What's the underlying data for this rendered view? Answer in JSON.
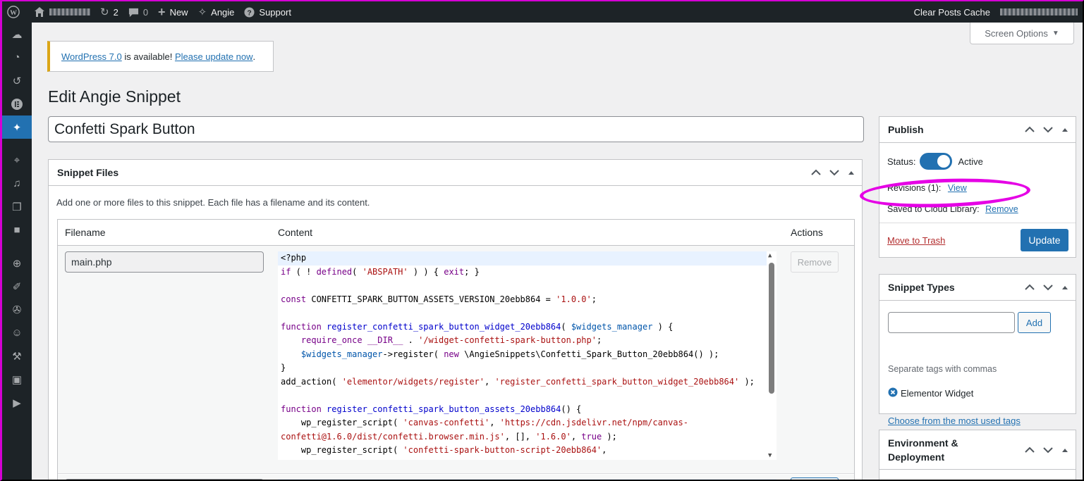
{
  "adminbar": {
    "updates_count": "2",
    "comments_count": "0",
    "new_label": "New",
    "angie_label": "Angie",
    "support_label": "Support",
    "clear_cache_label": "Clear Posts Cache"
  },
  "screen_options": {
    "label": "Screen Options"
  },
  "notice": {
    "version_link": "WordPress 7.0",
    "text": "is available!",
    "update_link": "Please update now",
    "period": "."
  },
  "page": {
    "title": "Edit Angie Snippet",
    "snippet_title": "Confetti Spark Button"
  },
  "snippet_files": {
    "heading": "Snippet Files",
    "description": "Add one or more files to this snippet. Each file has a filename and its content.",
    "col_filename": "Filename",
    "col_content": "Content",
    "col_actions": "Actions",
    "file1_name": "main.php",
    "remove_label": "Remove"
  },
  "publish": {
    "heading": "Publish",
    "status_label": "Status:",
    "status_value": "Active",
    "revisions_label": "Revisions (1):",
    "revisions_link": "View",
    "cloud_label": "Saved to Cloud Library:",
    "cloud_link": "Remove",
    "trash_link": "Move to Trash",
    "update_button": "Update"
  },
  "snippet_types": {
    "heading": "Snippet Types",
    "add_button": "Add",
    "hint": "Separate tags with commas",
    "tag": "Elementor Widget",
    "most_used_link": "Choose from the most used tags"
  },
  "environment": {
    "heading_line1": "Environment &",
    "heading_line2": "Deployment"
  },
  "colors": {
    "accent": "#2271b1",
    "annotation": "#e500e5",
    "notice_border": "#dba617"
  }
}
